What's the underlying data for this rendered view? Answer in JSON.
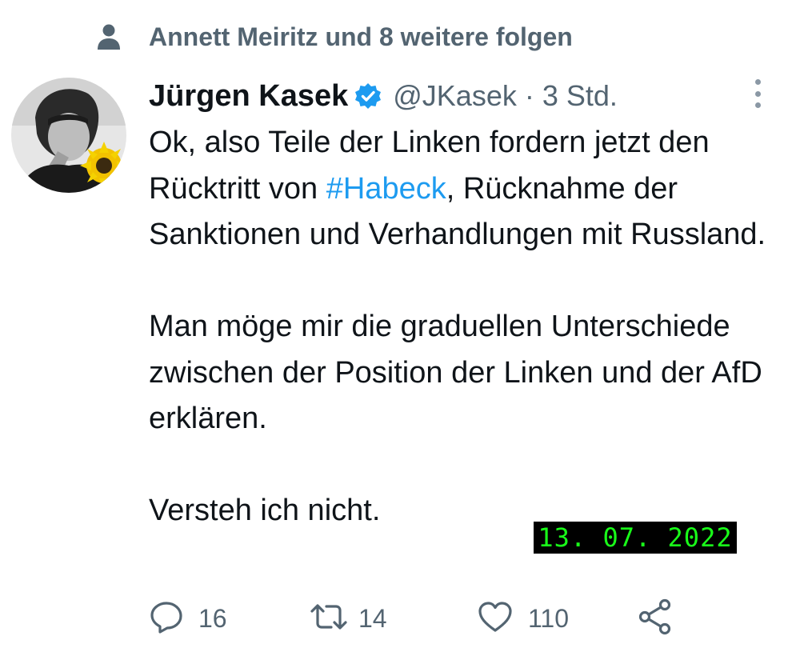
{
  "social_context": {
    "icon": "person-icon",
    "text": "Annett Meiritz und 8 weitere folgen"
  },
  "author": {
    "name": "Jürgen Kasek",
    "handle": "@JKasek",
    "separator": "·",
    "time": "3 Std.",
    "verified_icon": "verified-badge-icon"
  },
  "tweet": {
    "line1_pre": "Ok, also Teile der Linken fordern jetzt den Rücktritt von ",
    "hashtag": "#Habeck",
    "line1_post": ", Rücknahme der Sanktionen und Verhandlungen mit Russland.",
    "paragraph2": "Man möge mir die graduellen Unterschiede zwischen der Position der Linken und der AfD erklären.",
    "paragraph3": "Versteh ich nicht."
  },
  "date_stamp": "13. 07. 2022",
  "actions": {
    "reply_count": "16",
    "retweet_count": "14",
    "like_count": "110"
  },
  "colors": {
    "accent": "#1d9bf0",
    "secondary_text": "#536471",
    "stamp_bg": "#000000",
    "stamp_text": "#19ff19"
  }
}
